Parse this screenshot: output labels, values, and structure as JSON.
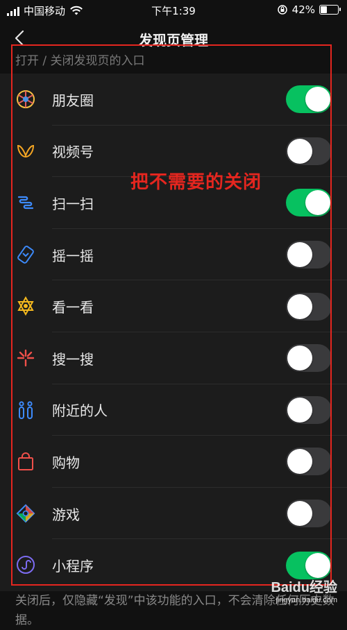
{
  "status_bar": {
    "carrier": "中国移动",
    "time": "下午1:39",
    "battery": "42%",
    "battery_level": 0.42
  },
  "nav": {
    "title": "发现页管理"
  },
  "section_header": "打开 / 关闭发现页的入口",
  "items": [
    {
      "label": "朋友圈",
      "icon": "moments-icon",
      "enabled": true
    },
    {
      "label": "视频号",
      "icon": "channels-icon",
      "enabled": false
    },
    {
      "label": "扫一扫",
      "icon": "scan-icon",
      "enabled": true
    },
    {
      "label": "摇一摇",
      "icon": "shake-icon",
      "enabled": false
    },
    {
      "label": "看一看",
      "icon": "top-stories-icon",
      "enabled": false
    },
    {
      "label": "搜一搜",
      "icon": "search-icon",
      "enabled": false
    },
    {
      "label": "附近的人",
      "icon": "people-nearby-icon",
      "enabled": false
    },
    {
      "label": "购物",
      "icon": "shopping-bag-icon",
      "enabled": false
    },
    {
      "label": "游戏",
      "icon": "games-icon",
      "enabled": false
    },
    {
      "label": "小程序",
      "icon": "mini-programs-icon",
      "enabled": true
    }
  ],
  "footer_note": "关闭后，仅隐藏“发现”中该功能的入口，不会清除任何历史数据。",
  "annotation": {
    "text": "把不需要的关闭",
    "color": "#e5261f"
  },
  "watermark": {
    "main": "Baidu经验",
    "sub": "jingyan.baidu.com"
  },
  "colors": {
    "toggle_on": "#07c160",
    "toggle_off": "#3a3a3c",
    "background": "#111111",
    "list_background": "#1c1c1c"
  }
}
